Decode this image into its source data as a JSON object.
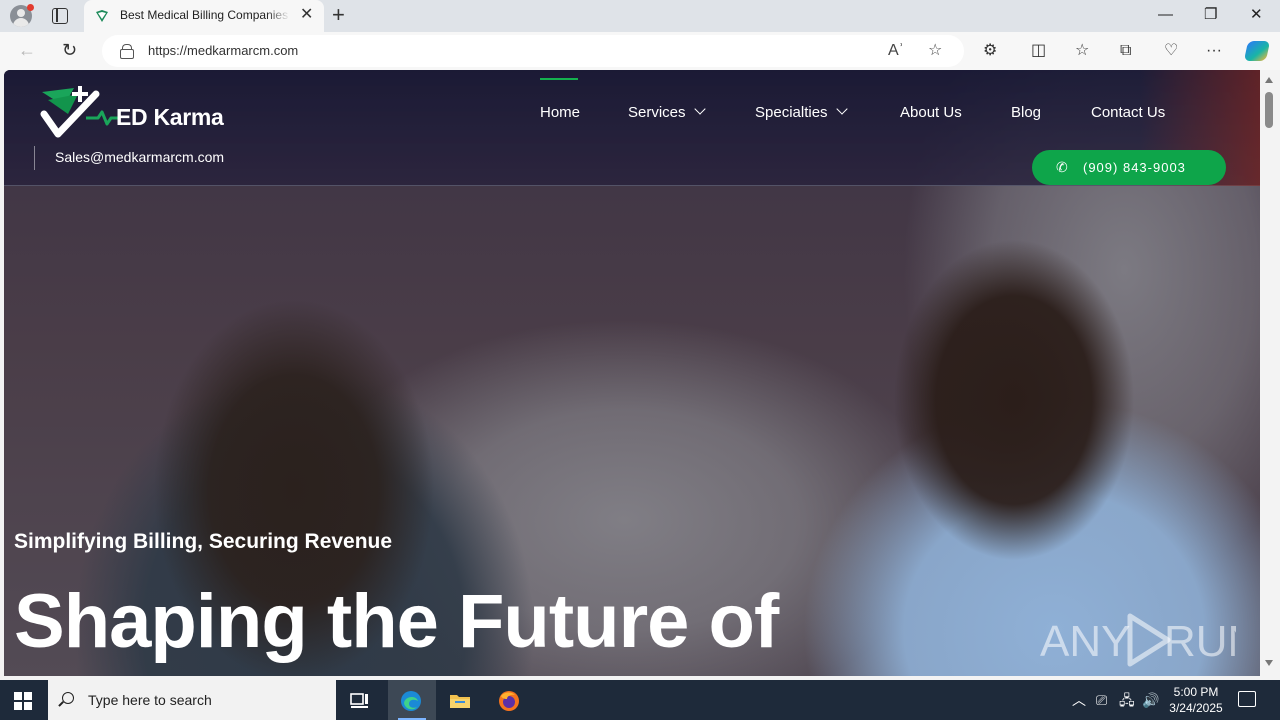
{
  "browser": {
    "tab_title": "Best Medical Billing Companies in",
    "url": "https://medkarmarcm.com",
    "window_controls": {
      "minimize": "—",
      "restore": "❐",
      "close": "✕"
    },
    "new_tab": "+",
    "tab_close": "✕",
    "nav": {
      "back": "←",
      "reload": "↻"
    },
    "omnibox_icons": {
      "read_aloud": "Aʾ",
      "favorite": "☆"
    },
    "toolbar_icons": {
      "extensions": "⚙",
      "split_screen": "◫",
      "favorites": "☆",
      "collections": "⧉",
      "browser_essentials": "♡",
      "more": "···"
    }
  },
  "site": {
    "logo_text": "ED Karma",
    "email": "Sales@medkarmarcm.com",
    "nav": {
      "home": "Home",
      "services": "Services",
      "specialties": "Specialties",
      "about": "About Us",
      "blog": "Blog",
      "contact": "Contact Us"
    },
    "phone": "(909) 843-9003",
    "tagline": "Simplifying Billing, Securing Revenue",
    "headline": "Shaping the Future of",
    "watermark": "ANY RUN"
  },
  "taskbar": {
    "search_placeholder": "Type here to search",
    "time": "5:00 PM",
    "date": "3/24/2025"
  },
  "colors": {
    "accent_green": "#0ea54a",
    "nav_active": "#15b04f",
    "taskbar": "#1e2a3a"
  }
}
